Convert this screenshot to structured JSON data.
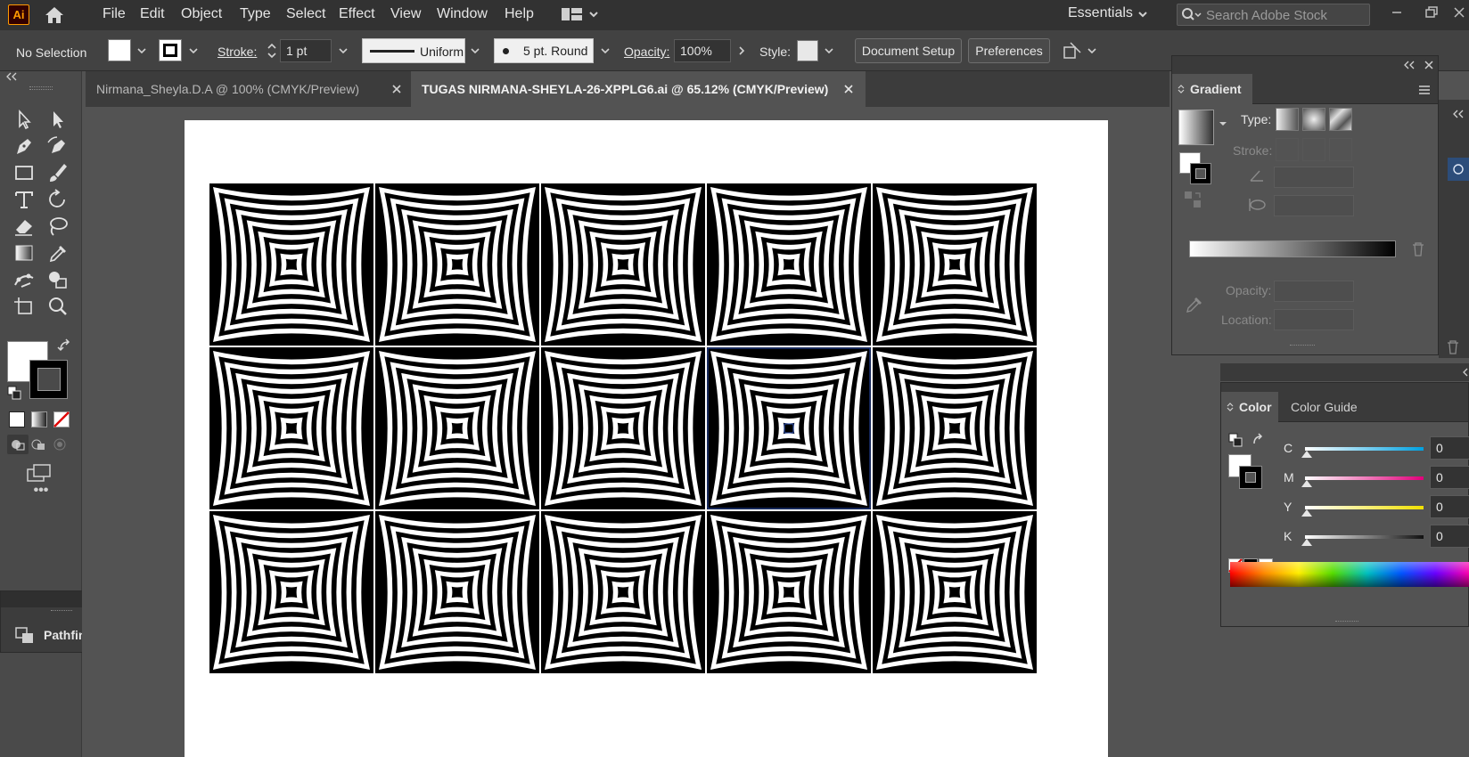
{
  "app": {
    "logo_text": "Ai",
    "brand_color": "#ff9a00"
  },
  "menubar": {
    "items": [
      "File",
      "Edit",
      "Object",
      "Type",
      "Select",
      "Effect",
      "View",
      "Window",
      "Help"
    ],
    "workspace": "Essentials",
    "search_placeholder": "Search Adobe Stock",
    "icons": [
      "home-icon",
      "workspace-switcher-icon",
      "search-icon",
      "minimize-icon",
      "restore-icon"
    ]
  },
  "controlbar": {
    "selection": "No Selection",
    "stroke_label": "Stroke:",
    "stroke_weight": "1 pt",
    "profile": "Uniform",
    "brush": "5 pt. Round",
    "opacity_label": "Opacity:",
    "opacity_value": "100%",
    "style_label": "Style:",
    "document_setup": "Document Setup",
    "preferences": "Preferences"
  },
  "tabs": [
    {
      "label": "Nirmana_Sheyla.D.A @ 100% (CMYK/Preview)",
      "active": false
    },
    {
      "label": "TUGAS NIRMANA-SHEYLA-26-XPPLG6.ai @ 65.12% (CMYK/Preview)",
      "active": true
    }
  ],
  "toolbar": {
    "tools": [
      "selection-tool",
      "direct-selection-tool",
      "pen-tool",
      "curvature-tool",
      "rectangle-tool",
      "paintbrush-tool",
      "type-tool",
      "rotate-tool",
      "eraser-tool",
      "lasso-tool",
      "gradient-tool",
      "eyedropper-tool",
      "puppet-warp-tool",
      "shape-builder-tool",
      "artboard-tool",
      "zoom-tool"
    ],
    "fill_color": "#ffffff",
    "stroke_color": "#000000",
    "more_label": "•••"
  },
  "pathfinder": {
    "title": "Pathfinder"
  },
  "artwork": {
    "rows": 3,
    "cols": 5,
    "rings_per_tile": 7,
    "selected_tile": [
      1,
      3
    ],
    "colors": {
      "ink": "#000000",
      "paper": "#ffffff",
      "selection": "#2b4fb5"
    }
  },
  "gradient_panel": {
    "title": "Gradient",
    "type_label": "Type:",
    "stroke_label": "Stroke:",
    "opacity_label": "Opacity:",
    "location_label": "Location:"
  },
  "color_panel": {
    "tab_color": "Color",
    "tab_color_guide": "Color Guide",
    "channels": [
      {
        "label": "C",
        "value": "0",
        "color": "#00a0e0"
      },
      {
        "label": "M",
        "value": "0",
        "color": "#e0007a"
      },
      {
        "label": "Y",
        "value": "0",
        "color": "#f0e000"
      },
      {
        "label": "K",
        "value": "0",
        "color": "#111111"
      }
    ]
  }
}
